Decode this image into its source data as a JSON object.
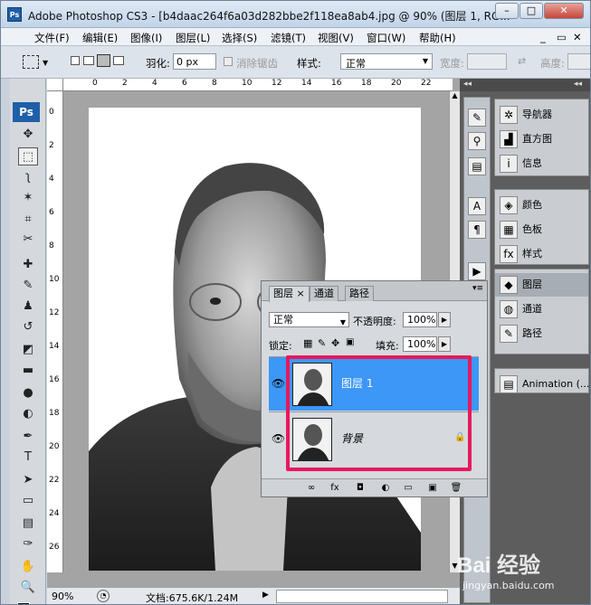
{
  "window": {
    "title": "Adobe Photoshop CS3 - [b4daac264f6a03d282bbe2f118ea8ab4.jpg @ 90% (图层 1, RG...",
    "logo_text": "Ps",
    "min_label": "–",
    "max_label": "□",
    "close_label": "✕"
  },
  "menubar": {
    "items": [
      "文件(F)",
      "编辑(E)",
      "图像(I)",
      "图层(L)",
      "选择(S)",
      "滤镜(T)",
      "视图(V)",
      "窗口(W)",
      "帮助(H)"
    ],
    "doc_controls": [
      "_",
      "▭",
      "✕"
    ]
  },
  "options": {
    "feather_label": "羽化:",
    "feather_value": "0 px",
    "antialias_label": "消除锯齿",
    "style_label": "样式:",
    "style_value": "正常",
    "width_label": "宽度:",
    "height_label": "高度:"
  },
  "toolbox": {
    "logo": "Ps",
    "tools": [
      "move-tool",
      "marquee-tool",
      "lasso-tool",
      "magic-wand-tool",
      "crop-tool",
      "slice-tool",
      "healing-tool",
      "brush-tool",
      "clone-stamp-tool",
      "history-brush-tool",
      "eraser-tool",
      "gradient-tool",
      "blur-tool",
      "dodge-tool",
      "pen-tool",
      "type-tool",
      "path-select-tool",
      "shape-tool",
      "notes-tool",
      "eyedropper-tool",
      "hand-tool",
      "zoom-tool"
    ],
    "tool_glyphs": [
      "✥",
      "⬚",
      "ʅ",
      "✶",
      "⌗",
      "✂",
      "✚",
      "✎",
      "♟",
      "↺",
      "◩",
      "▬",
      "●",
      "◐",
      "✒",
      "T",
      "➤",
      "▭",
      "▤",
      "✑",
      "✋",
      "🔍"
    ],
    "type_glyph": "T"
  },
  "rulers": {
    "h_ticks": [
      "0",
      "2",
      "4",
      "6",
      "8",
      "10",
      "12",
      "14",
      "16",
      "18",
      "20",
      "22"
    ],
    "v_ticks": [
      "0",
      "2",
      "4",
      "6",
      "8",
      "10",
      "12",
      "14",
      "16",
      "18",
      "20",
      "22",
      "24",
      "26"
    ]
  },
  "statusbar": {
    "zoom": "90%",
    "doc_info": "文档:675.6K/1.24M"
  },
  "dock": {
    "group1": [
      {
        "label": "导航器",
        "icon": "navigator-icon",
        "glyph": "✲"
      },
      {
        "label": "直方图",
        "icon": "histogram-icon",
        "glyph": "▟"
      },
      {
        "label": "信息",
        "icon": "info-icon",
        "glyph": "i"
      }
    ],
    "group2": [
      {
        "label": "颜色",
        "icon": "color-icon",
        "glyph": "◈"
      },
      {
        "label": "色板",
        "icon": "swatches-icon",
        "glyph": "▦"
      },
      {
        "label": "样式",
        "icon": "styles-icon",
        "glyph": "fx"
      }
    ],
    "group3": [
      {
        "label": "图层",
        "icon": "layers-icon",
        "glyph": "◆"
      },
      {
        "label": "通道",
        "icon": "channels-icon",
        "glyph": "◍"
      },
      {
        "label": "路径",
        "icon": "paths-icon",
        "glyph": "✎"
      }
    ],
    "group4": [
      {
        "label": "Animation (...",
        "icon": "animation-icon",
        "glyph": "▤"
      }
    ],
    "icon_col": [
      "✎",
      "⚲",
      "▤",
      "A",
      "¶",
      "▶"
    ]
  },
  "layers_panel": {
    "tabs": [
      "图层",
      "通道",
      "路径"
    ],
    "tab_close": "×",
    "blend_mode": "正常",
    "opacity_label": "不透明度:",
    "opacity_value": "100%",
    "lock_label": "锁定:",
    "fill_label": "填充:",
    "fill_value": "100%",
    "layers": [
      {
        "name": "图层 1",
        "selected": true
      },
      {
        "name": "背景",
        "selected": false,
        "locked": true
      }
    ],
    "bottom_icons": [
      "link-icon",
      "fx-icon",
      "mask-icon",
      "adjustment-icon",
      "folder-icon",
      "new-layer-icon",
      "trash-icon"
    ],
    "bottom_glyphs": [
      "∞",
      "fx",
      "◘",
      "◐",
      "▭",
      "▣",
      "🗑"
    ],
    "menu_glyph": "▾≡",
    "collapse_glyph": "◂◂",
    "lock_glyph": "🔒",
    "eye_glyph": "👁"
  },
  "watermark": {
    "brand": "Bai 经验",
    "url": "jingyan.baidu.com"
  },
  "colors": {
    "selected_layer": "#3c97f7",
    "highlight_box": "#e8185c",
    "dock_bg": "#5d5d5d"
  }
}
